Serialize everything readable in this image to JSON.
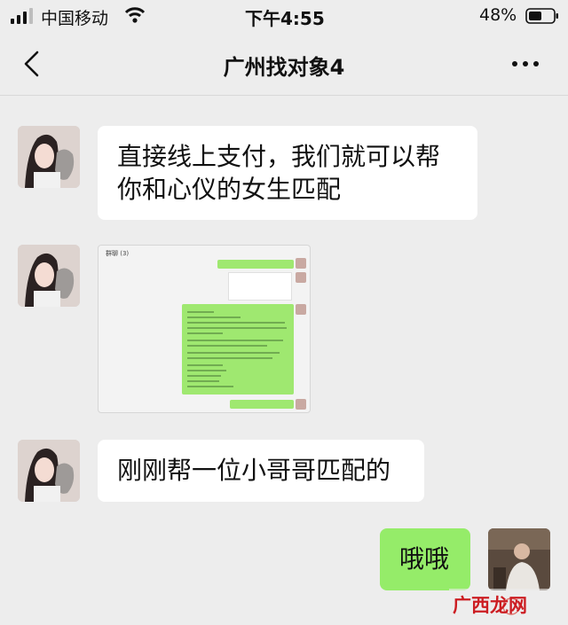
{
  "status": {
    "carrier": "中国移动",
    "time": "下午4:55",
    "battery": "48%"
  },
  "nav": {
    "title": "广州找对象4"
  },
  "messages": [
    {
      "text": "直接线上支付，我们就可以帮\n你和心仪的女生匹配"
    },
    {
      "text": "刚刚帮一位小哥哥匹配的"
    },
    {
      "text": "哦哦"
    }
  ],
  "screenshot": {
    "header": "群聊 (3)"
  },
  "watermark": {
    "brand": "广西龙网"
  },
  "icons": [
    "signal-icon",
    "wifi-icon",
    "battery-icon",
    "back-arrow-icon",
    "more-dots-icon"
  ]
}
